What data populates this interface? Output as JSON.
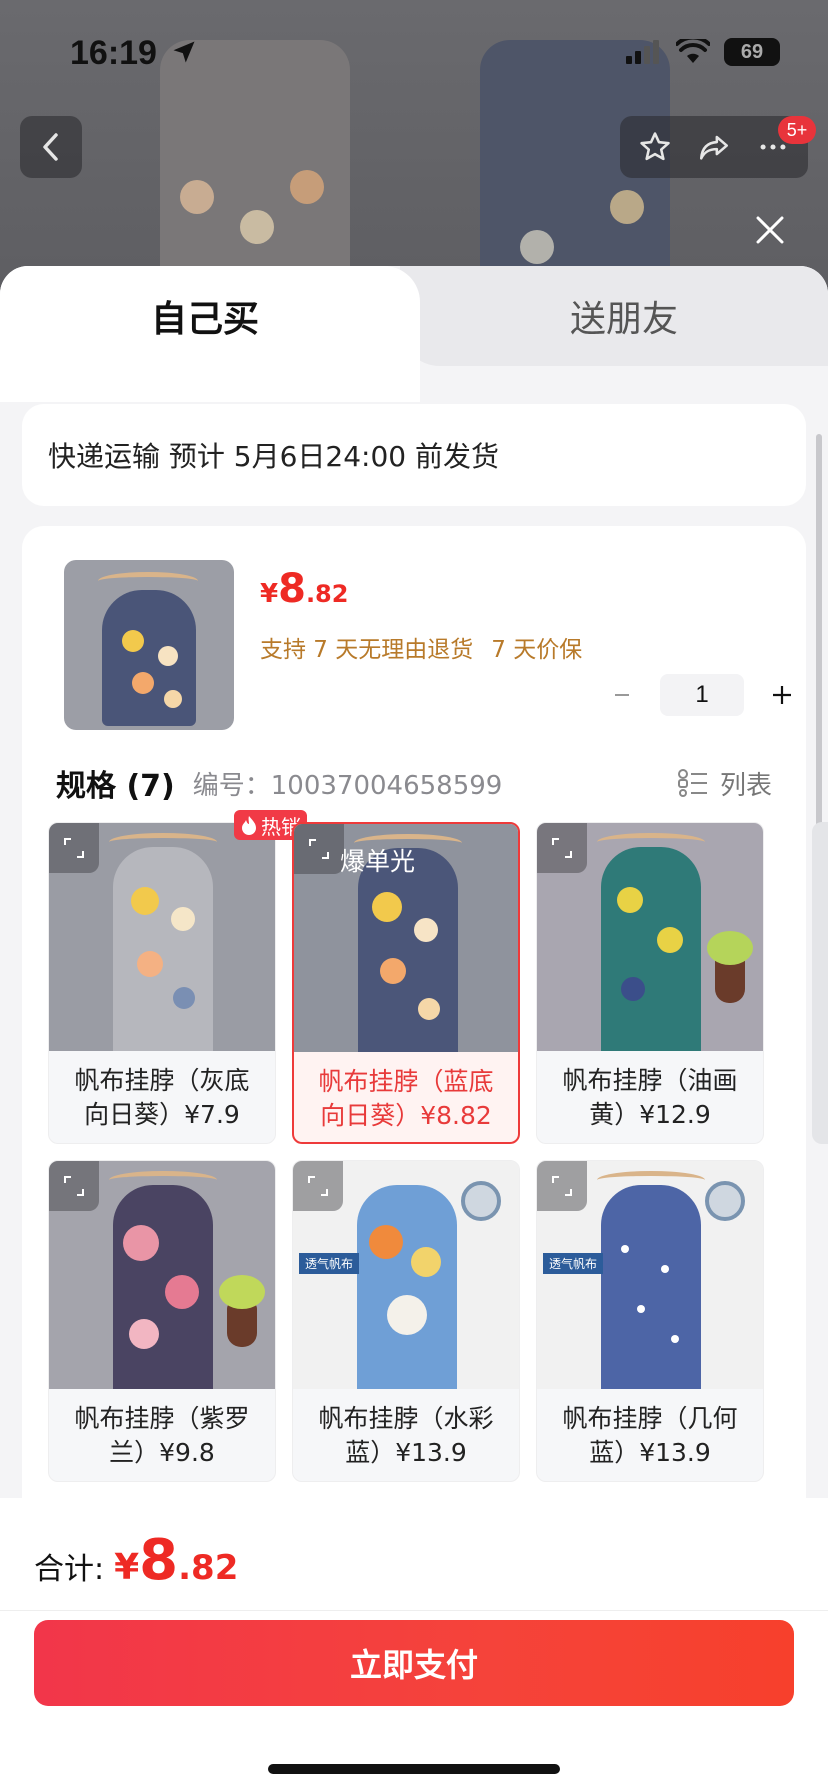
{
  "status_bar": {
    "time": "16:19",
    "battery": "69"
  },
  "nav": {
    "cart_badge": "5+"
  },
  "tabs": {
    "self_buy": "自己买",
    "gift": "送朋友"
  },
  "shipping": {
    "text": "快递运输 预计 5月6日24:00 前发货"
  },
  "product": {
    "price_symbol": "¥",
    "price_int": "8",
    "price_dec": ".82",
    "policy_return": "支持 7 天无理由退货",
    "policy_price": "7 天价保",
    "quantity": "1"
  },
  "spec": {
    "title": "规格 (7)",
    "code": "编号：10037004658599",
    "list_label": "列表",
    "items": [
      {
        "label": "帆布挂脖（灰底向日葵）¥7.9",
        "badge": "热销",
        "selected": false
      },
      {
        "label": "帆布挂脖（蓝底向日葵）¥8.82",
        "tag": "爆单光",
        "selected": true
      },
      {
        "label": "帆布挂脖（油画黄）¥12.9",
        "selected": false
      },
      {
        "label": "帆布挂脖（紫罗兰）¥9.8",
        "selected": false
      },
      {
        "label": "帆布挂脖（水彩蓝）¥13.9",
        "fabric_tag": "透气帆布",
        "selected": false
      },
      {
        "label": "帆布挂脖（几何蓝）¥13.9",
        "fabric_tag": "透气帆布",
        "selected": false
      }
    ]
  },
  "footer": {
    "total_label": "合计:",
    "total_symbol": "¥",
    "total_int": "8",
    "total_dec": ".82",
    "pay_label": "立即支付"
  },
  "colors": {
    "accent": "#ee2a24",
    "policy": "#b87a2a",
    "selected_border": "#ee3a3a"
  }
}
